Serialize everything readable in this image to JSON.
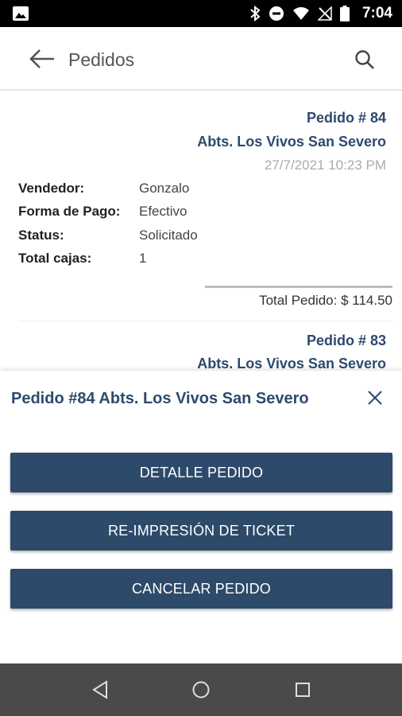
{
  "status_bar": {
    "time": "7:04",
    "icons": [
      "image-icon",
      "bluetooth-icon",
      "do-not-disturb-icon",
      "wifi-icon",
      "no-signal-icon",
      "battery-icon"
    ]
  },
  "app_bar": {
    "title": "Pedidos",
    "back_icon": "arrow-left-icon",
    "search_icon": "search-icon"
  },
  "orders": [
    {
      "number": "Pedido # 84",
      "client": "Abts. Los Vivos San Severo",
      "date": "27/7/2021 10:23 PM",
      "details": [
        {
          "label": "Vendedor:",
          "value": "Gonzalo"
        },
        {
          "label": "Forma de Pago:",
          "value": "Efectivo"
        },
        {
          "label": "Status:",
          "value": "Solicitado"
        },
        {
          "label": "Total cajas:",
          "value": "1"
        }
      ],
      "total": "Total Pedido: $ 114.50"
    },
    {
      "number": "Pedido # 83",
      "client": "Abts. Los Vivos San Severo"
    }
  ],
  "sheet": {
    "title": "Pedido #84 Abts. Los Vivos San Severo",
    "close_icon": "close-icon",
    "actions": [
      {
        "label": "DETALLE PEDIDO"
      },
      {
        "label": "RE-IMPRESIÓN DE TICKET"
      },
      {
        "label": "CANCELAR PEDIDO"
      }
    ]
  },
  "nav_bar": {
    "icons": [
      "nav-back-icon",
      "nav-home-icon",
      "nav-recents-icon"
    ]
  },
  "colors": {
    "accent": "#2d4a6e",
    "button": "#2e4a6a",
    "date": "#aaaaaa",
    "nav_bar": "#4a4a4a"
  }
}
